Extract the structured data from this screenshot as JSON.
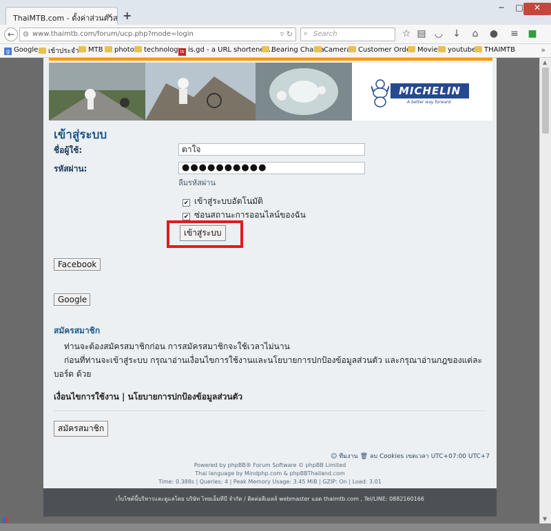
{
  "browser": {
    "tab_title": "ThaiMTB.com - ตั้งค่าส่วนตัวสมา...",
    "url": "www.thaimtb.com/forum/ucp.php?mode=login",
    "search_placeholder": "Search",
    "bookmarks": [
      "Google",
      "เข้าประจำ",
      "MTB",
      "photo",
      "technology",
      "is.gd - a URL shortener...",
      "Bearing Chaina",
      "Camera",
      "Customer Order",
      "Movie",
      "youtube",
      "THAIMTB"
    ]
  },
  "banner": {
    "brand": "MICHELIN",
    "tagline": "A better way forward"
  },
  "login": {
    "title": "เข้าสู่ระบบ",
    "username_label": "ชื่อผู้ใช้:",
    "username_value": "ตาใจ",
    "password_label": "รหัสผ่าน:",
    "password_value": "●●●●●●●●●●",
    "forgot_link": "ลืมรหัสผ่าน",
    "auto_login_label": "เข้าสู่ระบบอัตโนมัติ",
    "hide_online_label": "ซ่อนสถานะการออนไลน์ของฉัน",
    "submit_label": "เข้าสู่ระบบ",
    "facebook_label": "Facebook",
    "google_label": "Google"
  },
  "register": {
    "title": "สมัครสมาชิก",
    "line1": "ท่านจะต้องสมัครสมาชิกก่อน การสมัครสมาชิกจะใช้เวลาไม่นาน",
    "line2": "ก่อนที่ท่านจะเข้าสู่ระบบ กรุณาอ่านเงื่อนไขการใช้งานและนโยบายการปกป้องข้อมูลส่วนตัว และกรุณาอ่านกฎของแต่ละ",
    "line3": "บอร์ด ด้วย",
    "terms": "เงื่อนไขการใช้งาน | นโยบายการปกป้องข้อมูลส่วนตัว",
    "button_label": "สมัครสมาชิก"
  },
  "footer": {
    "team": "ทีมงาน",
    "delete_cookies": "ลบ Cookies",
    "timezone": "เขตเวลา UTC+07:00 UTC+7",
    "powered": "Powered by phpBB® Forum Software © phpBB Limited",
    "thai_lang": "Thai language by Mindphp.com & phpBBThailand.com",
    "stats": "Time: 0.388s | Queries: 4 | Peak Memory Usage: 3.45 MiB | GZIP: On | Load: 3.01",
    "bottom_text": "เว็บไซต์นี้บริหารและดูแลโดย บริษัท ไทยเอ็มทีบี จำกัด / ติดต่อลีเมลล์ webmaster แอด thaimtb.com , Tel/LINE: 0882160166"
  }
}
